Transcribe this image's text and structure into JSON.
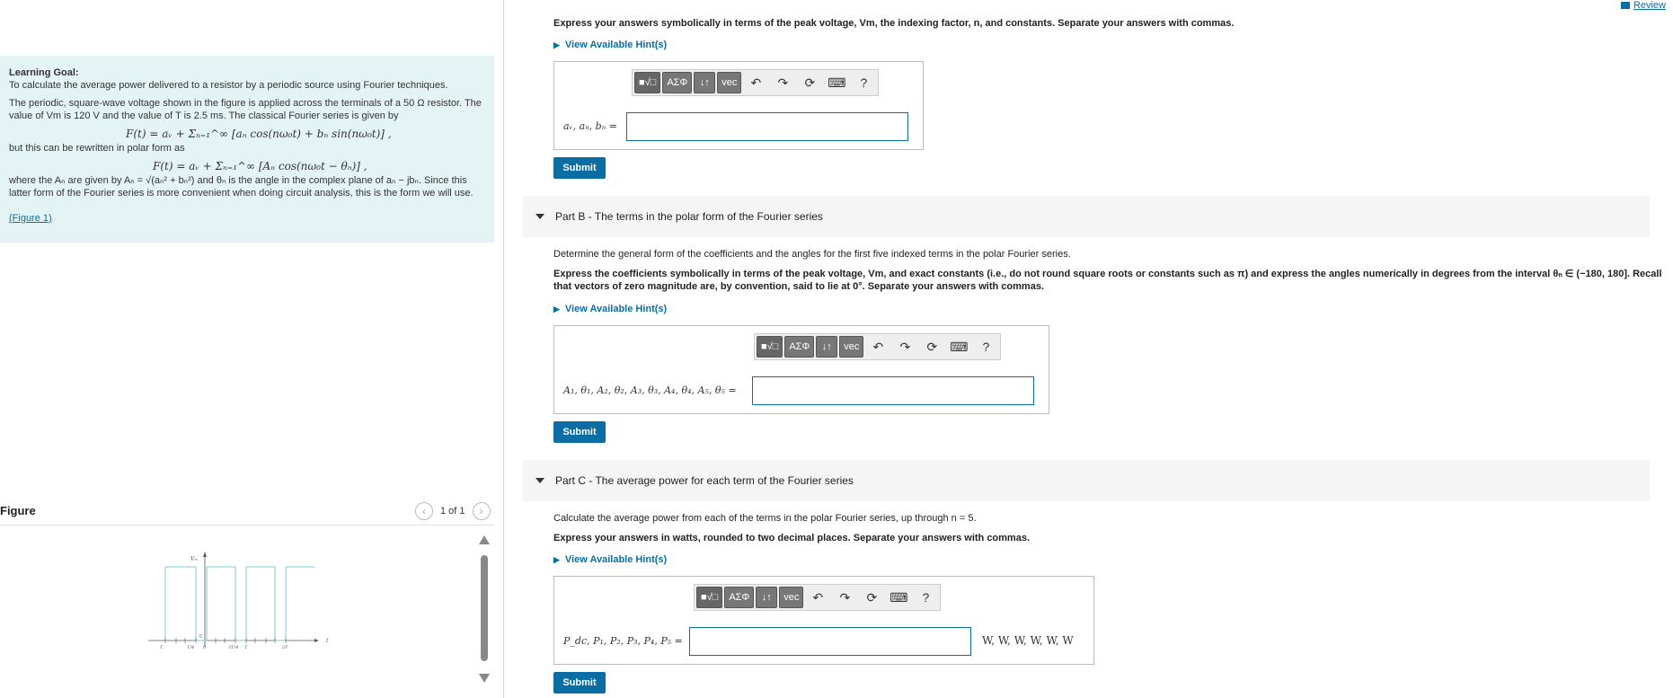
{
  "review": {
    "label": "Review"
  },
  "learning": {
    "goal_title": "Learning Goal:",
    "goal_text": "To calculate the average power delivered to a resistor by a periodic source using Fourier techniques.",
    "para1": "The periodic, square-wave voltage shown in the figure is applied across the terminals of a 50 Ω resistor. The value of Vm is 120 V and the value of T is 2.5 ms. The classical Fourier series is given by",
    "eq1": "F(t) = aᵥ + Σₙ₌₁^∞ [aₙ cos(nω₀t) + bₙ sin(nω₀t)] ,",
    "para2": "but this can be rewritten in polar form as",
    "eq2": "F(t) = aᵥ + Σₙ₌₁^∞ [Aₙ cos(nω₀t − θₙ)] ,",
    "para3": "where the Aₙ are given by Aₙ = √(aₙ² + bₙ²) and θₙ is the angle in the complex plane of aₙ − jbₙ. Since this latter form of the Fourier series is more convenient when doing circuit analysis, this is the form we will use.",
    "figure_link": "(Figure 1)"
  },
  "figure": {
    "title": "Figure",
    "pager": "1 of 1",
    "axis_y": "Vₘ",
    "axis_x": "t",
    "origin": "0",
    "ticks": [
      "T",
      "T/4",
      "0",
      "3T/4",
      "T",
      "2T"
    ]
  },
  "partA": {
    "instruction": "Express your answers symbolically in terms of the peak voltage, Vm, the indexing factor, n, and constants. Separate your answers with commas.",
    "hint": "View Available Hint(s)",
    "label": "aᵥ, aₙ, bₙ =",
    "submit": "Submit"
  },
  "partB": {
    "part": "Part B",
    "title": " - The terms in the polar form of the Fourier series",
    "instruction1": "Determine the general form of the coefficients and the angles for the first five indexed terms in the polar Fourier series.",
    "instruction2": "Express the coefficients symbolically in terms of the peak voltage, Vm, and exact constants (i.e., do not round square roots or constants such as π) and express the angles numerically in degrees from the interval θₙ ∈ (−180, 180]. Recall that vectors of zero magnitude are, by convention, said to lie at 0°. Separate your answers with commas.",
    "hint": "View Available Hint(s)",
    "label": "A₁, θ₁, A₂, θ₂, A₃, θ₃, A₄, θ₄, A₅, θ₅ =",
    "submit": "Submit"
  },
  "partC": {
    "part": "Part C",
    "title": " - The average power for each term of the Fourier series",
    "instruction1": "Calculate the average power from each of the terms in the polar Fourier series, up through n = 5.",
    "instruction2": "Express your answers in watts, rounded to two decimal places. Separate your answers with commas.",
    "hint": "View Available Hint(s)",
    "label": "P_dc, P₁, P₂, P₃, P₄, P₅ =",
    "units": "W, W, W, W, W, W",
    "submit": "Submit"
  },
  "toolbar": {
    "templates": "■√□",
    "symbols": "ΑΣΦ",
    "arrows": "↓↑",
    "vec": "vec",
    "undo": "↶",
    "redo": "↷",
    "reset": "⟳",
    "keyboard": "⌨",
    "help": "?"
  }
}
